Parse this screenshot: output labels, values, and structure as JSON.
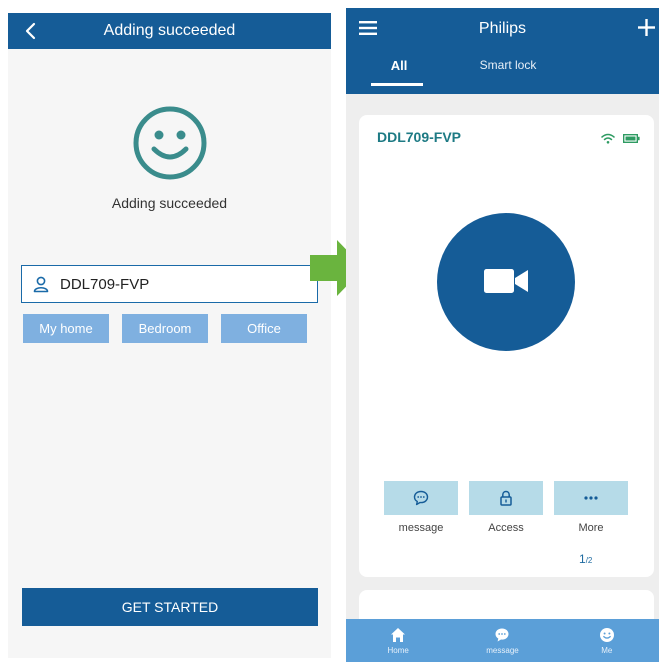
{
  "left": {
    "header_title": "Adding succeeded",
    "success_message": "Adding succeeded",
    "device_name_value": "DDL709-FVP",
    "room_tags": [
      "My home",
      "Bedroom",
      "Office"
    ],
    "get_started_label": "GET STARTED"
  },
  "right": {
    "header_title": "Philips",
    "tabs": [
      "All",
      "Smart lock"
    ],
    "device_card": {
      "name": "DDL709-FVP",
      "actions": [
        "message",
        "Access",
        "More"
      ],
      "page_current": "1",
      "page_total": "/2"
    },
    "bottom_nav": [
      "Home",
      "message",
      "Me"
    ]
  },
  "colors": {
    "brand_blue": "#155c97",
    "tag_blue": "#7fb0e0",
    "action_bg": "#b6dbe8",
    "nav_blue": "#5b9fd8",
    "arrow_green": "#6ab43e",
    "device_name_teal": "#1d7a84"
  }
}
